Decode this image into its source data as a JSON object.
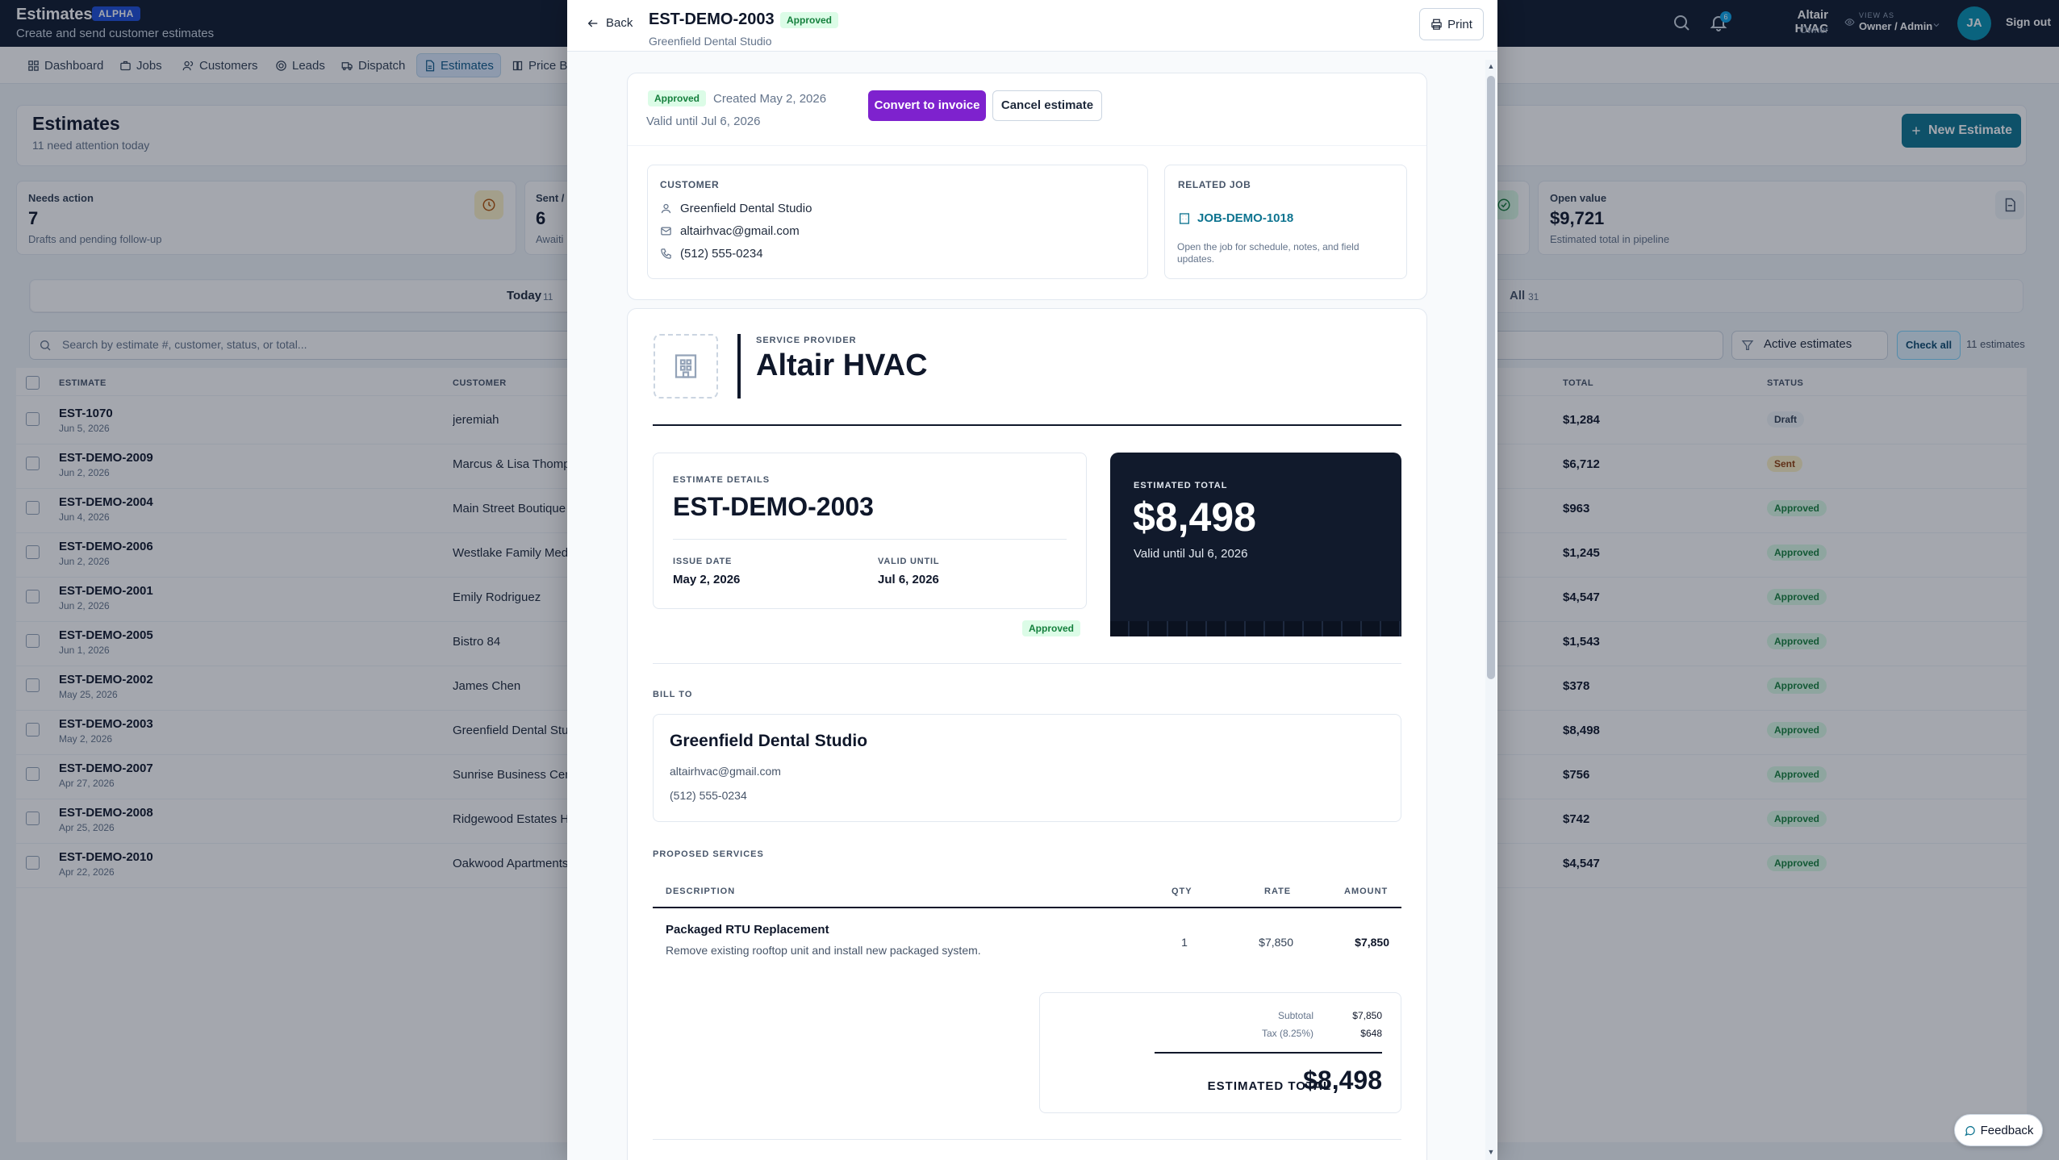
{
  "app": {
    "title": "Estimates",
    "badge": "ALPHA",
    "subtitle": "Create and send customer estimates"
  },
  "topbar": {
    "notification_count": "6",
    "user_name": "Altair HVAC",
    "user_role": "Owner",
    "view_as_label": "VIEW AS",
    "view_as_value": "Owner / Admin",
    "avatar_initials": "JA",
    "sign_out": "Sign out"
  },
  "nav": [
    "Dashboard",
    "Jobs",
    "Customers",
    "Leads",
    "Dispatch",
    "Estimates",
    "Price B"
  ],
  "page": {
    "title": "Estimates",
    "subtitle": "11 need attention today",
    "new_button": "New Estimate"
  },
  "stats": [
    {
      "label": "Needs action",
      "value": "7",
      "note": "Drafts and pending follow-up"
    },
    {
      "label": "Sent /",
      "value": "6",
      "note": "Awaiti"
    },
    {
      "label": "Open value",
      "value": "$9,721",
      "note": "Estimated total in pipeline"
    }
  ],
  "tabs": [
    {
      "label": "Today",
      "count": "11"
    },
    {
      "label": "All",
      "count": "31"
    }
  ],
  "filters": {
    "search_placeholder": "Search by estimate #, customer, status, or total...",
    "active_filter": "Active estimates",
    "check_all": "Check all",
    "count": "11 estimates"
  },
  "table": {
    "headers": {
      "estimate": "ESTIMATE",
      "customer": "CUSTOMER",
      "total": "TOTAL",
      "status": "STATUS"
    },
    "rows": [
      {
        "estimate": "EST-1070",
        "date": "Jun 5, 2026",
        "customer": "jeremiah",
        "total": "$1,284",
        "status": "Draft"
      },
      {
        "estimate": "EST-DEMO-2009",
        "date": "Jun 2, 2026",
        "customer": "Marcus & Lisa Thomps",
        "total": "$6,712",
        "status": "Sent"
      },
      {
        "estimate": "EST-DEMO-2004",
        "date": "Jun 4, 2026",
        "customer": "Main Street Boutique",
        "total": "$963",
        "status": "Approved"
      },
      {
        "estimate": "EST-DEMO-2006",
        "date": "Jun 2, 2026",
        "customer": "Westlake Family Medi",
        "total": "$1,245",
        "status": "Approved"
      },
      {
        "estimate": "EST-DEMO-2001",
        "date": "Jun 2, 2026",
        "customer": "Emily Rodriguez",
        "total": "$4,547",
        "status": "Approved"
      },
      {
        "estimate": "EST-DEMO-2005",
        "date": "Jun 1, 2026",
        "customer": "Bistro 84",
        "total": "$1,543",
        "status": "Approved"
      },
      {
        "estimate": "EST-DEMO-2002",
        "date": "May 25, 2026",
        "customer": "James Chen",
        "total": "$378",
        "status": "Approved"
      },
      {
        "estimate": "EST-DEMO-2003",
        "date": "May 2, 2026",
        "customer": "Greenfield Dental Stu",
        "total": "$8,498",
        "status": "Approved"
      },
      {
        "estimate": "EST-DEMO-2007",
        "date": "Apr 27, 2026",
        "customer": "Sunrise Business Cen",
        "total": "$756",
        "status": "Approved"
      },
      {
        "estimate": "EST-DEMO-2008",
        "date": "Apr 25, 2026",
        "customer": "Ridgewood Estates H",
        "total": "$742",
        "status": "Approved"
      },
      {
        "estimate": "EST-DEMO-2010",
        "date": "Apr 22, 2026",
        "customer": "Oakwood Apartments",
        "total": "$4,547",
        "status": "Approved"
      }
    ]
  },
  "feedback": "Feedback",
  "drawer": {
    "back": "Back",
    "title": "EST-DEMO-2003",
    "status": "Approved",
    "subtitle": "Greenfield Dental Studio",
    "print": "Print",
    "summary": {
      "status": "Approved",
      "created": "Created May 2, 2026",
      "valid": "Valid until Jul 6, 2026",
      "convert": "Convert to invoice",
      "cancel": "Cancel estimate"
    },
    "customer": {
      "label": "CUSTOMER",
      "name": "Greenfield Dental Studio",
      "email": "altairhvac@gmail.com",
      "phone": "(512) 555-0234"
    },
    "related_job": {
      "label": "RELATED JOB",
      "job": "JOB-DEMO-1018",
      "note": "Open the job for schedule, notes, and field updates."
    },
    "document": {
      "provider_label": "SERVICE PROVIDER",
      "provider_name": "Altair HVAC",
      "details_label": "ESTIMATE DETAILS",
      "number": "EST-DEMO-2003",
      "issue_label": "ISSUE DATE",
      "issue_date": "May 2, 2026",
      "valid_label": "VALID UNTIL",
      "valid_date": "Jul 6, 2026",
      "status": "Approved",
      "total_label": "ESTIMATED TOTAL",
      "total": "$8,498",
      "total_valid": "Valid until Jul 6, 2026",
      "bill_to_label": "BILL TO",
      "bill_name": "Greenfield Dental Studio",
      "bill_email": "altairhvac@gmail.com",
      "bill_phone": "(512) 555-0234",
      "services_label": "PROPOSED SERVICES",
      "headers": {
        "description": "DESCRIPTION",
        "qty": "QTY",
        "rate": "RATE",
        "amount": "AMOUNT"
      },
      "line": {
        "name": "Packaged RTU Replacement",
        "description": "Remove existing rooftop unit and install new packaged system.",
        "qty": "1",
        "rate": "$7,850",
        "amount": "$7,850"
      },
      "subtotal_label": "Subtotal",
      "subtotal": "$7,850",
      "tax_label": "Tax (8.25%)",
      "tax": "$648",
      "grand_label": "ESTIMATED TOTAL",
      "grand_total": "$8,498"
    }
  }
}
